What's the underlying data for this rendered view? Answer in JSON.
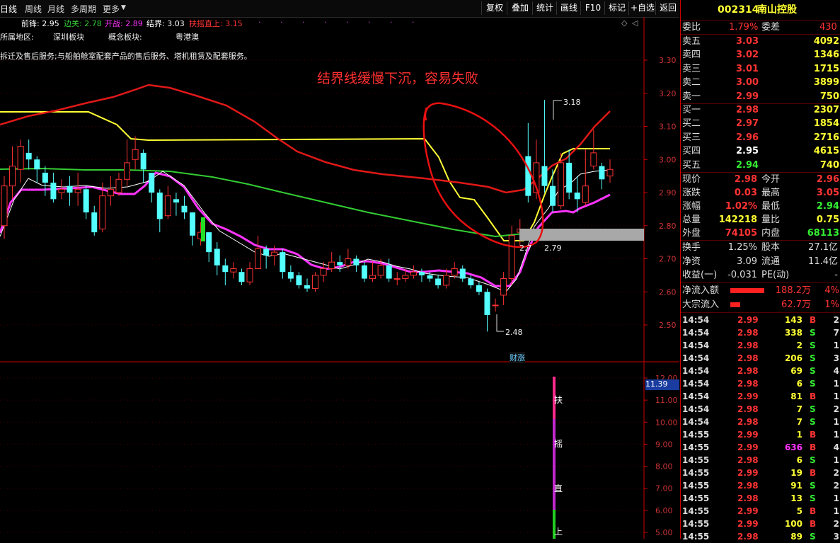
{
  "tabs": [
    "日线",
    "周线",
    "月线",
    "多周期",
    "更多"
  ],
  "toolbar": [
    "复权",
    "叠加",
    "统计",
    "画线",
    "F10",
    "标记",
    "+自选",
    "返回"
  ],
  "legend": {
    "qianfeng": "前锋: 2.95",
    "bianguan": "边关: 2.78",
    "kaizhan": "开战: 2.89",
    "jiejie": "结界: 3.03",
    "fuyao": "扶摇直上: 3.15"
  },
  "info": {
    "region": "所属地区:",
    "shenzhen": "深圳板块",
    "concept": "概念板块:",
    "concept_val": "粤港澳",
    "business": "拆迁及售后服务;与船舶舱室配套产品的售后服务、塔机租赁及配套服务。"
  },
  "annotation": "结界线缓慢下沉，容易失败",
  "labels": {
    "hi": "3.18",
    "mid": "2.79",
    "mid_left": "2.7",
    "low": "2.48",
    "caizhang": "财涨",
    "cur_val": "11.39"
  },
  "vertical_text": [
    "扶",
    "摇",
    "直",
    "上"
  ],
  "yaxis_main": [
    "3.30",
    "3.20",
    "3.10",
    "3.00",
    "2.90",
    "2.80",
    "2.70",
    "2.60",
    "2.50"
  ],
  "yaxis_sub": [
    "12.00",
    "11.00",
    "10.00",
    "9.00",
    "8.00",
    "7.00",
    "6.00",
    "5.00"
  ],
  "stock": {
    "code": "002314",
    "name": "南山控股"
  },
  "weibi": {
    "label": "委比",
    "value": "1.79%",
    "label2": "委差",
    "value2": "430"
  },
  "asks": [
    {
      "label": "卖五",
      "price": "3.03",
      "vol": "4092"
    },
    {
      "label": "卖四",
      "price": "3.02",
      "vol": "1346"
    },
    {
      "label": "卖三",
      "price": "3.01",
      "vol": "1715"
    },
    {
      "label": "卖二",
      "price": "3.00",
      "vol": "3899"
    },
    {
      "label": "卖一",
      "price": "2.99",
      "vol": "750"
    }
  ],
  "bids": [
    {
      "label": "买一",
      "price": "2.98",
      "vol": "2307"
    },
    {
      "label": "买二",
      "price": "2.97",
      "vol": "1854"
    },
    {
      "label": "买三",
      "price": "2.96",
      "vol": "2716"
    },
    {
      "label": "买四",
      "price": "2.95",
      "vol": "4615"
    },
    {
      "label": "买五",
      "price": "2.94",
      "vol": "740"
    }
  ],
  "quote": [
    {
      "l1": "现价",
      "v1": "2.98",
      "l2": "今开",
      "v2": "2.96"
    },
    {
      "l1": "涨跌",
      "v1": "0.03",
      "l2": "最高",
      "v2": "3.05"
    },
    {
      "l1": "涨幅",
      "v1": "1.02%",
      "l2": "最低",
      "v2": "2.94"
    },
    {
      "l1": "总量",
      "v1": "142218",
      "l2": "量比",
      "v2": "0.75"
    },
    {
      "l1": "外盘",
      "v1": "74105",
      "l2": "内盘",
      "v2": "68113"
    }
  ],
  "fund": [
    {
      "l1": "换手",
      "v1": "1.25%",
      "l2": "股本",
      "v2": "27.1亿"
    },
    {
      "l1": "净资",
      "v1": "3.09",
      "l2": "流通",
      "v2": "11.4亿"
    },
    {
      "l1": "收益(一)",
      "v1": "-0.031",
      "l2": "PE(动)",
      "v2": "-"
    }
  ],
  "flow": [
    {
      "label": "净流入额",
      "value": "188.2万",
      "pct": "4%"
    },
    {
      "label": "大宗流入",
      "value": "62.7万",
      "pct": "1%"
    }
  ],
  "ticks": [
    {
      "t": "14:54",
      "p": "2.99",
      "v": "143",
      "s": "B",
      "n": "2"
    },
    {
      "t": "14:54",
      "p": "2.98",
      "v": "338",
      "s": "S",
      "n": "7"
    },
    {
      "t": "14:54",
      "p": "2.98",
      "v": "2",
      "s": "S",
      "n": "1"
    },
    {
      "t": "14:54",
      "p": "2.98",
      "v": "206",
      "s": "S",
      "n": "3"
    },
    {
      "t": "14:54",
      "p": "2.98",
      "v": "69",
      "s": "S",
      "n": "4"
    },
    {
      "t": "14:54",
      "p": "2.98",
      "v": "6",
      "s": "S",
      "n": "1"
    },
    {
      "t": "14:54",
      "p": "2.99",
      "v": "81",
      "s": "B",
      "n": "1"
    },
    {
      "t": "14:54",
      "p": "2.98",
      "v": "7",
      "s": "S",
      "n": "2"
    },
    {
      "t": "14:54",
      "p": "2.98",
      "v": "7",
      "s": "S",
      "n": "1"
    },
    {
      "t": "14:55",
      "p": "2.99",
      "v": "1",
      "s": "B",
      "n": "1"
    },
    {
      "t": "14:55",
      "p": "2.99",
      "v": "636",
      "s": "B",
      "n": "4"
    },
    {
      "t": "14:55",
      "p": "2.98",
      "v": "6",
      "s": "S",
      "n": "1"
    },
    {
      "t": "14:55",
      "p": "2.99",
      "v": "19",
      "s": "B",
      "n": "2"
    },
    {
      "t": "14:55",
      "p": "2.98",
      "v": "91",
      "s": "S",
      "n": "2"
    },
    {
      "t": "14:55",
      "p": "2.98",
      "v": "13",
      "s": "S",
      "n": "1"
    },
    {
      "t": "14:55",
      "p": "2.99",
      "v": "5",
      "s": "B",
      "n": "1"
    },
    {
      "t": "14:55",
      "p": "2.99",
      "v": "100",
      "s": "B",
      "n": "2"
    },
    {
      "t": "14:55",
      "p": "2.98",
      "v": "89",
      "s": "S",
      "n": "3"
    }
  ],
  "colors": {
    "up": "#ff3333",
    "down": "#54ffff",
    "yellow": "#ffff33",
    "magenta": "#ff33ff",
    "green": "#33cc33",
    "red": "#e01818"
  },
  "chart_data": {
    "type": "candlestick",
    "ylim": [
      2.45,
      3.35
    ],
    "candles": [
      [
        2.8,
        2.92,
        2.95,
        2.76
      ],
      [
        2.92,
        2.98,
        3.04,
        2.88
      ],
      [
        2.97,
        3.04,
        3.06,
        2.93
      ],
      [
        3.02,
        3.0,
        3.06,
        2.97
      ],
      [
        3.0,
        2.97,
        3.01,
        2.93
      ],
      [
        2.96,
        2.93,
        2.98,
        2.89
      ],
      [
        2.93,
        2.88,
        2.96,
        2.87
      ],
      [
        2.9,
        2.91,
        2.94,
        2.88
      ],
      [
        2.92,
        2.9,
        2.95,
        2.86
      ],
      [
        2.9,
        2.91,
        2.96,
        2.86
      ],
      [
        2.91,
        2.84,
        2.92,
        2.82
      ],
      [
        2.84,
        2.78,
        2.86,
        2.77
      ],
      [
        2.79,
        2.89,
        2.93,
        2.78
      ],
      [
        2.89,
        2.91,
        2.95,
        2.86
      ],
      [
        2.9,
        2.94,
        2.96,
        2.89
      ],
      [
        2.94,
        2.99,
        3.06,
        2.92
      ],
      [
        3.0,
        3.03,
        3.07,
        2.97
      ],
      [
        3.02,
        2.97,
        3.03,
        2.93
      ],
      [
        2.96,
        2.9,
        2.96,
        2.87
      ],
      [
        2.9,
        2.82,
        2.91,
        2.78
      ],
      [
        2.83,
        2.89,
        2.92,
        2.82
      ],
      [
        2.88,
        2.87,
        2.9,
        2.83
      ],
      [
        2.86,
        2.84,
        2.89,
        2.82
      ],
      [
        2.84,
        2.77,
        2.84,
        2.74
      ],
      [
        2.76,
        2.78,
        2.81,
        2.74
      ],
      [
        2.78,
        2.72,
        2.78,
        2.69
      ],
      [
        2.73,
        2.68,
        2.75,
        2.65
      ],
      [
        2.68,
        2.66,
        2.7,
        2.62
      ],
      [
        2.66,
        2.67,
        2.69,
        2.64
      ],
      [
        2.66,
        2.63,
        2.67,
        2.62
      ],
      [
        2.63,
        2.67,
        2.69,
        2.62
      ],
      [
        2.67,
        2.73,
        2.77,
        2.67
      ],
      [
        2.73,
        2.71,
        2.74,
        2.67
      ],
      [
        2.71,
        2.72,
        2.74,
        2.68
      ],
      [
        2.72,
        2.66,
        2.73,
        2.64
      ],
      [
        2.66,
        2.64,
        2.68,
        2.63
      ],
      [
        2.65,
        2.62,
        2.66,
        2.61
      ],
      [
        2.62,
        2.61,
        2.64,
        2.6
      ],
      [
        2.61,
        2.65,
        2.66,
        2.6
      ],
      [
        2.65,
        2.67,
        2.69,
        2.63
      ],
      [
        2.67,
        2.69,
        2.72,
        2.66
      ],
      [
        2.69,
        2.68,
        2.71,
        2.66
      ],
      [
        2.68,
        2.7,
        2.73,
        2.67
      ],
      [
        2.7,
        2.68,
        2.71,
        2.66
      ],
      [
        2.68,
        2.64,
        2.69,
        2.63
      ],
      [
        2.64,
        2.65,
        2.69,
        2.63
      ],
      [
        2.65,
        2.68,
        2.7,
        2.64
      ],
      [
        2.68,
        2.64,
        2.7,
        2.63
      ],
      [
        2.64,
        2.64,
        2.66,
        2.62
      ],
      [
        2.64,
        2.65,
        2.67,
        2.63
      ],
      [
        2.65,
        2.66,
        2.68,
        2.64
      ],
      [
        2.66,
        2.65,
        2.67,
        2.63
      ],
      [
        2.65,
        2.64,
        2.66,
        2.63
      ],
      [
        2.64,
        2.62,
        2.65,
        2.61
      ],
      [
        2.62,
        2.65,
        2.67,
        2.61
      ],
      [
        2.65,
        2.67,
        2.69,
        2.64
      ],
      [
        2.67,
        2.64,
        2.68,
        2.63
      ],
      [
        2.64,
        2.62,
        2.65,
        2.61
      ],
      [
        2.62,
        2.6,
        2.63,
        2.59
      ],
      [
        2.6,
        2.53,
        2.61,
        2.48
      ],
      [
        2.56,
        2.56,
        2.58,
        2.54
      ],
      [
        2.59,
        2.64,
        2.66,
        2.56
      ],
      [
        2.64,
        2.77,
        2.8,
        2.62
      ],
      [
        2.78,
        2.79,
        2.82,
        2.74
      ],
      [
        3.01,
        2.89,
        3.11,
        2.87
      ],
      [
        2.9,
        2.99,
        3.06,
        2.88
      ],
      [
        2.98,
        2.92,
        3.18,
        2.9
      ],
      [
        2.92,
        2.86,
        2.97,
        2.84
      ],
      [
        2.86,
        2.99,
        3.02,
        2.85
      ],
      [
        2.99,
        2.9,
        3.03,
        2.88
      ],
      [
        2.9,
        2.88,
        2.95,
        2.84
      ],
      [
        2.87,
        2.92,
        3.03,
        2.86
      ],
      [
        2.98,
        3.02,
        3.09,
        2.97
      ],
      [
        2.98,
        2.94,
        2.99,
        2.91
      ],
      [
        2.95,
        2.97,
        3.0,
        2.93
      ]
    ]
  }
}
